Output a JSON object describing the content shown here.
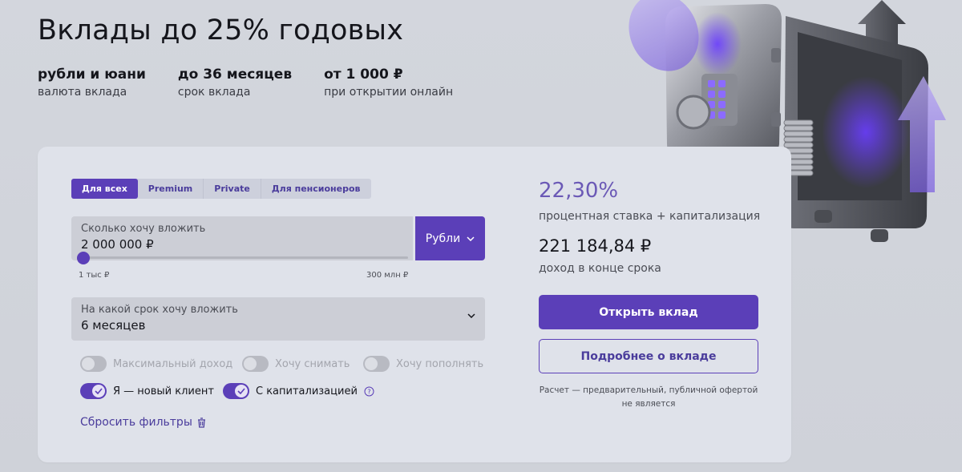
{
  "hero": {
    "title": "Вклады до 25% годовых",
    "facts": [
      {
        "value": "рубли и юани",
        "caption": "валюта вклада"
      },
      {
        "value": "до 36 месяцев",
        "caption": "срок вклада"
      },
      {
        "value": "от 1 000 ₽",
        "caption": "при открытии онлайн"
      }
    ]
  },
  "segments": {
    "items": [
      "Для всех",
      "Premium",
      "Private",
      "Для пенсионеров"
    ],
    "selected": "Для всех"
  },
  "amount": {
    "label": "Сколько хочу вложить",
    "value": "2 000 000 ₽",
    "min_label": "1 тыс ₽",
    "max_label": "300 млн ₽",
    "slider_fraction": 0.007
  },
  "currency": {
    "label": "Рубли"
  },
  "term": {
    "label": "На какой срок хочу вложить",
    "value": "6 месяцев"
  },
  "toggles": [
    {
      "label": "Максимальный доход",
      "on": false
    },
    {
      "label": "Хочу снимать",
      "on": false
    },
    {
      "label": "Хочу пополнять",
      "on": false
    },
    {
      "label": "Я — новый клиент",
      "on": true
    },
    {
      "label": "С капитализацией",
      "on": true
    }
  ],
  "reset": {
    "label": "Сбросить фильтры"
  },
  "result": {
    "rate": "22,30%",
    "rate_caption": "процентная ставка + капитализация",
    "income": "221 184,84 ₽",
    "income_caption": "доход в конце срока"
  },
  "actions": {
    "open": "Открыть вклад",
    "details": "Подробнее о вкладе"
  },
  "disclaimer": "Расчет — предварительный, публичной офертой не является",
  "colors": {
    "accent": "#5b3fb8",
    "accent_text": "#4a3c9c",
    "rate": "#6b59b6"
  }
}
